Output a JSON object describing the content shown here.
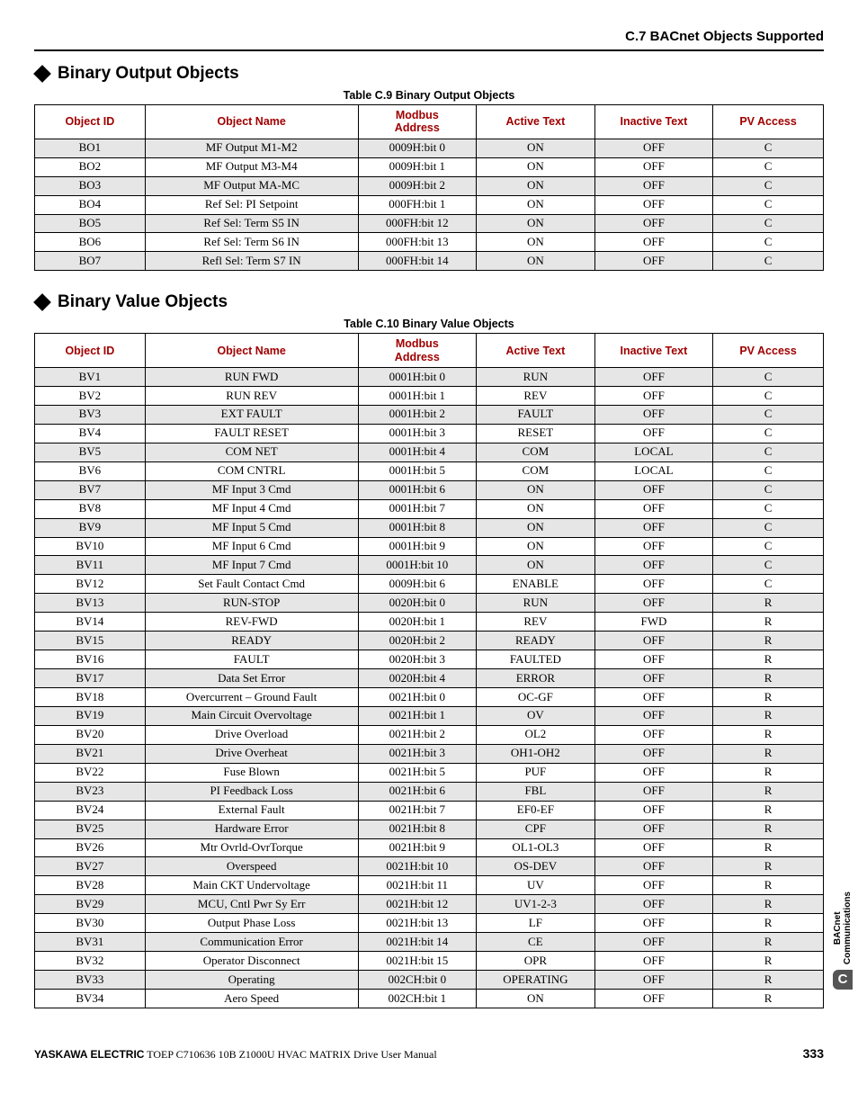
{
  "header": {
    "title": "C.7 BACnet Objects Supported"
  },
  "sections": [
    {
      "title": "Binary Output Objects",
      "caption": "Table C.9  Binary Output Objects",
      "columns": [
        "Object ID",
        "Object Name",
        "Modbus Address",
        "Active Text",
        "Inactive Text",
        "PV Access"
      ],
      "rows": [
        [
          "BO1",
          "MF Output M1-M2",
          "0009H:bit 0",
          "ON",
          "OFF",
          "C"
        ],
        [
          "BO2",
          "MF Output M3-M4",
          "0009H:bit 1",
          "ON",
          "OFF",
          "C"
        ],
        [
          "BO3",
          "MF Output MA-MC",
          "0009H:bit 2",
          "ON",
          "OFF",
          "C"
        ],
        [
          "BO4",
          "Ref Sel: PI Setpoint",
          "000FH:bit 1",
          "ON",
          "OFF",
          "C"
        ],
        [
          "BO5",
          "Ref Sel: Term S5 IN",
          "000FH:bit 12",
          "ON",
          "OFF",
          "C"
        ],
        [
          "BO6",
          "Ref Sel: Term S6 IN",
          "000FH:bit 13",
          "ON",
          "OFF",
          "C"
        ],
        [
          "BO7",
          "Refl Sel: Term S7 IN",
          "000FH:bit 14",
          "ON",
          "OFF",
          "C"
        ]
      ]
    },
    {
      "title": "Binary Value Objects",
      "caption": "Table C.10  Binary Value Objects",
      "columns": [
        "Object ID",
        "Object Name",
        "Modbus Address",
        "Active Text",
        "Inactive Text",
        "PV Access"
      ],
      "rows": [
        [
          "BV1",
          "RUN FWD",
          "0001H:bit 0",
          "RUN",
          "OFF",
          "C"
        ],
        [
          "BV2",
          "RUN REV",
          "0001H:bit 1",
          "REV",
          "OFF",
          "C"
        ],
        [
          "BV3",
          "EXT FAULT",
          "0001H:bit 2",
          "FAULT",
          "OFF",
          "C"
        ],
        [
          "BV4",
          "FAULT RESET",
          "0001H:bit 3",
          "RESET",
          "OFF",
          "C"
        ],
        [
          "BV5",
          "COM NET",
          "0001H:bit 4",
          "COM",
          "LOCAL",
          "C"
        ],
        [
          "BV6",
          "COM CNTRL",
          "0001H:bit 5",
          "COM",
          "LOCAL",
          "C"
        ],
        [
          "BV7",
          "MF Input 3 Cmd",
          "0001H:bit 6",
          "ON",
          "OFF",
          "C"
        ],
        [
          "BV8",
          "MF Input 4 Cmd",
          "0001H:bit 7",
          "ON",
          "OFF",
          "C"
        ],
        [
          "BV9",
          "MF Input 5 Cmd",
          "0001H:bit 8",
          "ON",
          "OFF",
          "C"
        ],
        [
          "BV10",
          "MF Input 6 Cmd",
          "0001H:bit 9",
          "ON",
          "OFF",
          "C"
        ],
        [
          "BV11",
          "MF Input 7 Cmd",
          "0001H:bit 10",
          "ON",
          "OFF",
          "C"
        ],
        [
          "BV12",
          "Set Fault Contact Cmd",
          "0009H:bit 6",
          "ENABLE",
          "OFF",
          "C"
        ],
        [
          "BV13",
          "RUN-STOP",
          "0020H:bit 0",
          "RUN",
          "OFF",
          "R"
        ],
        [
          "BV14",
          "REV-FWD",
          "0020H:bit 1",
          "REV",
          "FWD",
          "R"
        ],
        [
          "BV15",
          "READY",
          "0020H:bit 2",
          "READY",
          "OFF",
          "R"
        ],
        [
          "BV16",
          "FAULT",
          "0020H:bit 3",
          "FAULTED",
          "OFF",
          "R"
        ],
        [
          "BV17",
          "Data Set Error",
          "0020H:bit 4",
          "ERROR",
          "OFF",
          "R"
        ],
        [
          "BV18",
          "Overcurrent – Ground Fault",
          "0021H:bit 0",
          "OC-GF",
          "OFF",
          "R"
        ],
        [
          "BV19",
          "Main Circuit Overvoltage",
          "0021H:bit 1",
          "OV",
          "OFF",
          "R"
        ],
        [
          "BV20",
          "Drive Overload",
          "0021H:bit 2",
          "OL2",
          "OFF",
          "R"
        ],
        [
          "BV21",
          "Drive Overheat",
          "0021H:bit 3",
          "OH1-OH2",
          "OFF",
          "R"
        ],
        [
          "BV22",
          "Fuse Blown",
          "0021H:bit 5",
          "PUF",
          "OFF",
          "R"
        ],
        [
          "BV23",
          "PI Feedback Loss",
          "0021H:bit 6",
          "FBL",
          "OFF",
          "R"
        ],
        [
          "BV24",
          "External Fault",
          "0021H:bit 7",
          "EF0-EF",
          "OFF",
          "R"
        ],
        [
          "BV25",
          "Hardware Error",
          "0021H:bit 8",
          "CPF",
          "OFF",
          "R"
        ],
        [
          "BV26",
          "Mtr Ovrld-OvrTorque",
          "0021H:bit 9",
          "OL1-OL3",
          "OFF",
          "R"
        ],
        [
          "BV27",
          "Overspeed",
          "0021H:bit 10",
          "OS-DEV",
          "OFF",
          "R"
        ],
        [
          "BV28",
          "Main CKT Undervoltage",
          "0021H:bit 11",
          "UV",
          "OFF",
          "R"
        ],
        [
          "BV29",
          "MCU, Cntl Pwr Sy Err",
          "0021H:bit 12",
          "UV1-2-3",
          "OFF",
          "R"
        ],
        [
          "BV30",
          "Output Phase Loss",
          "0021H:bit 13",
          "LF",
          "OFF",
          "R"
        ],
        [
          "BV31",
          "Communication Error",
          "0021H:bit 14",
          "CE",
          "OFF",
          "R"
        ],
        [
          "BV32",
          "Operator Disconnect",
          "0021H:bit 15",
          "OPR",
          "OFF",
          "R"
        ],
        [
          "BV33",
          "Operating",
          "002CH:bit 0",
          "OPERATING",
          "OFF",
          "R"
        ],
        [
          "BV34",
          "Aero Speed",
          "002CH:bit 1",
          "ON",
          "OFF",
          "R"
        ]
      ]
    }
  ],
  "footer": {
    "brand": "YASKAWA ELECTRIC",
    "rest": " TOEP C710636 10B Z1000U HVAC MATRIX Drive User Manual",
    "page": "333"
  },
  "side_tab": {
    "line1": "BACnet",
    "line2": "Communications",
    "badge": "C"
  }
}
